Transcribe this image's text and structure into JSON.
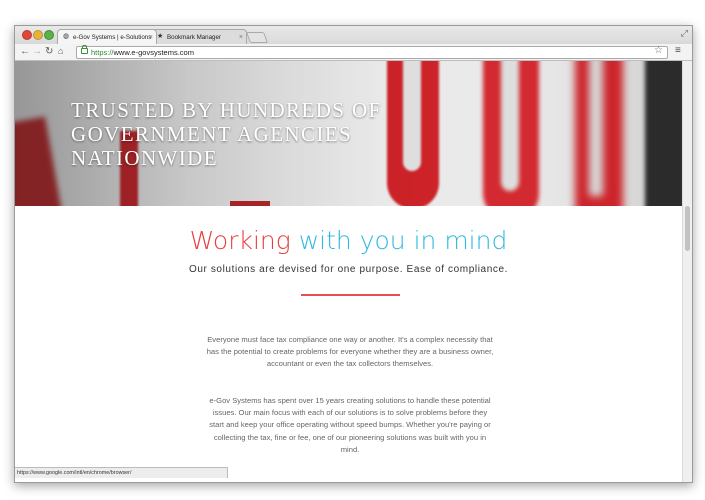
{
  "browser": {
    "tabs": [
      {
        "label": "e-Gov Systems | e-Solutions",
        "active": true,
        "icon": "globe-icon"
      },
      {
        "label": "Bookmark Manager",
        "active": false,
        "icon": "star-icon"
      }
    ],
    "url_protocol": "https://",
    "url_rest": "www.e-govsystems.com",
    "status_url": "https://www.google.com/intl/en/chrome/browser/"
  },
  "hero": {
    "title": "TRUSTED BY HUNDREDS OF GOVERNMENT AGENCIES NATIONWIDE"
  },
  "main": {
    "heading_part1": "Working",
    "heading_part2": "with you in mind",
    "subheading": "Our solutions are devised for one purpose. Ease of compliance.",
    "paragraphs": [
      "Everyone must face tax compliance one way or another. It's a complex necessity that has the potential to create problems for everyone whether they are a business owner, accountant or even the tax collectors themselves.",
      "e-Gov Systems has spent over 15 years creating solutions to handle these potential issues. Our main focus with each of our solutions is to solve problems before they start and keep your office operating without speed bumps. Whether you're paying or collecting the tax, fine or fee, one of our pioneering solutions was built with you in mind."
    ]
  },
  "colors": {
    "accent_red": "#e83c3c",
    "accent_blue": "#2fb8e0",
    "divider": "#e4505a"
  }
}
